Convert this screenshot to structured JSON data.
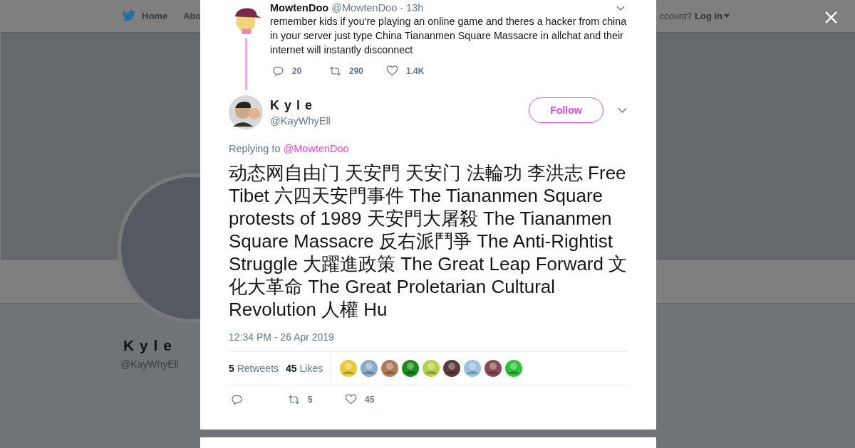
{
  "nav": {
    "items": [
      {
        "label": "Home"
      },
      {
        "label": "Abo"
      }
    ],
    "login_prompt": "ccount?",
    "login": "Log in"
  },
  "profile": {
    "name": "K y l e",
    "handle": "@KayWhyEll"
  },
  "parent_tweet": {
    "name": "MowtenDoo",
    "handle": "@MowtenDoo",
    "time": "· 13h",
    "text": "remember kids if you're playing an online game and theres a hacker from china in your server just type China Tiananmen Square Massacre in allchat and their internet will instantly disconnect",
    "replies": "20",
    "retweets": "290",
    "likes": "1.4K"
  },
  "tweet": {
    "name": "K y l e",
    "handle": "@KayWhyEll",
    "follow": "Follow",
    "replying_label": "Replying to",
    "replying_to": "@MowtenDoo",
    "text": "动态网自由门 天安門 天安门 法輪功 李洪志 Free Tibet 六四天安門事件 The Tiananmen Square protests of 1989 天安門大屠殺 The Tiananmen Square Massacre 反右派鬥爭 The Anti-Rightist Struggle 大躍進政策 The Great Leap Forward 文化大革命 The Great Proletarian Cultural Revolution 人權 Hu",
    "timestamp": "12:34 PM - 26 Apr 2019",
    "retweet_count": "5",
    "retweet_label": "Retweets",
    "like_count": "45",
    "like_label": "Likes",
    "retweets": "5",
    "likes": "45"
  }
}
